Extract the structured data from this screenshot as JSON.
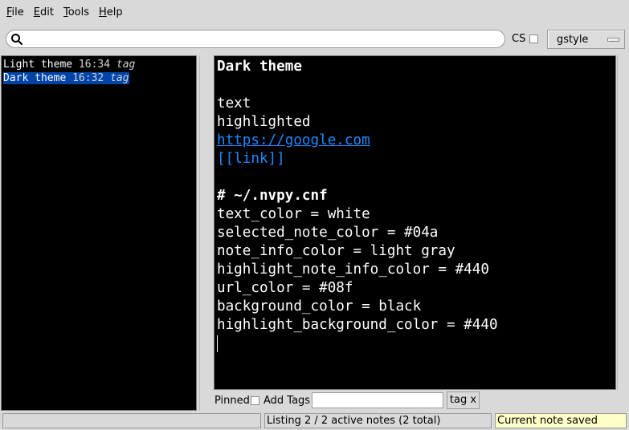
{
  "menu": {
    "file": {
      "mnemonic": "F",
      "rest": "ile"
    },
    "edit": {
      "mnemonic": "E",
      "rest": "dit"
    },
    "tools": {
      "mnemonic": "T",
      "rest": "ools"
    },
    "help": {
      "mnemonic": "H",
      "rest": "elp"
    }
  },
  "search": {
    "value": "",
    "icon": "search-icon",
    "cs_label": "CS",
    "cs_checked": false,
    "style_selected": "gstyle"
  },
  "note_list": [
    {
      "title": "Light theme",
      "time": "16:34",
      "tag": "tag",
      "selected": false
    },
    {
      "title": "Dark theme",
      "time": "16:32",
      "tag": "tag",
      "selected": true
    }
  ],
  "editor": {
    "lines": [
      "Dark theme",
      "",
      "text",
      "highlighted",
      "https://google.com",
      "[[link]]",
      "",
      "# ~/.nvpy.cnf",
      "text_color = white",
      "selected_note_color = #04a",
      "note_info_color = light gray",
      "highlight_note_info_color = #440",
      "url_color = #08f",
      "background_color = black",
      "highlight_background_color = #440"
    ]
  },
  "editor_bar": {
    "pinned_label": "Pinned",
    "pinned_checked": false,
    "add_tags_label": "Add Tags",
    "add_tags_value": "",
    "tag_button_label": "tag x"
  },
  "status": {
    "left": "",
    "middle": "Listing 2 / 2 active notes (2 total)",
    "right": "Current note saved"
  },
  "colors": {
    "window_bg": "#d9d9d9",
    "editor_bg": "#000000",
    "text": "#ffffff",
    "selected_note": "#0044aa",
    "url": "#1e88ff",
    "status_saved_bg": "#ffffc8"
  }
}
